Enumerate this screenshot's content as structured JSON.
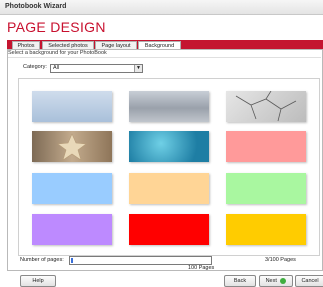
{
  "window": {
    "title": "Photobook Wizard"
  },
  "header": {
    "title": "PAGE DESIGN"
  },
  "tabs": [
    {
      "label": "Photos"
    },
    {
      "label": "Selected photos"
    },
    {
      "label": "Page layout"
    },
    {
      "label": "Background",
      "active": true
    }
  ],
  "content": {
    "subheading": "Select a background for your PhotoBook",
    "category_label": "Category:",
    "category_value": "All"
  },
  "backgrounds": [
    {
      "name": "light-blue-sky",
      "color": "#b9cde3"
    },
    {
      "name": "grey-clouds",
      "color": "#a8afb7"
    },
    {
      "name": "cracked-earth",
      "color": "#d4d4d4"
    },
    {
      "name": "starfish-sand",
      "color": "#a88f72"
    },
    {
      "name": "blue-water",
      "color": "#2a8eb0"
    },
    {
      "name": "pink",
      "color": "#ff9a9a"
    },
    {
      "name": "light-blue",
      "color": "#99ccff"
    },
    {
      "name": "peach",
      "color": "#ffd596"
    },
    {
      "name": "light-green",
      "color": "#a9f7a0"
    },
    {
      "name": "lavender",
      "color": "#bd8aff"
    },
    {
      "name": "red",
      "color": "#ff0000"
    },
    {
      "name": "yellow",
      "color": "#ffcc00"
    }
  ],
  "footer": {
    "pages_label": "Number of pages:",
    "pages_progress": 0.01,
    "pages_count": "3/100 Pages",
    "pages_max": "100 Pages",
    "help": "Help",
    "back": "Back",
    "next": "Next",
    "cancel": "Cancel"
  }
}
